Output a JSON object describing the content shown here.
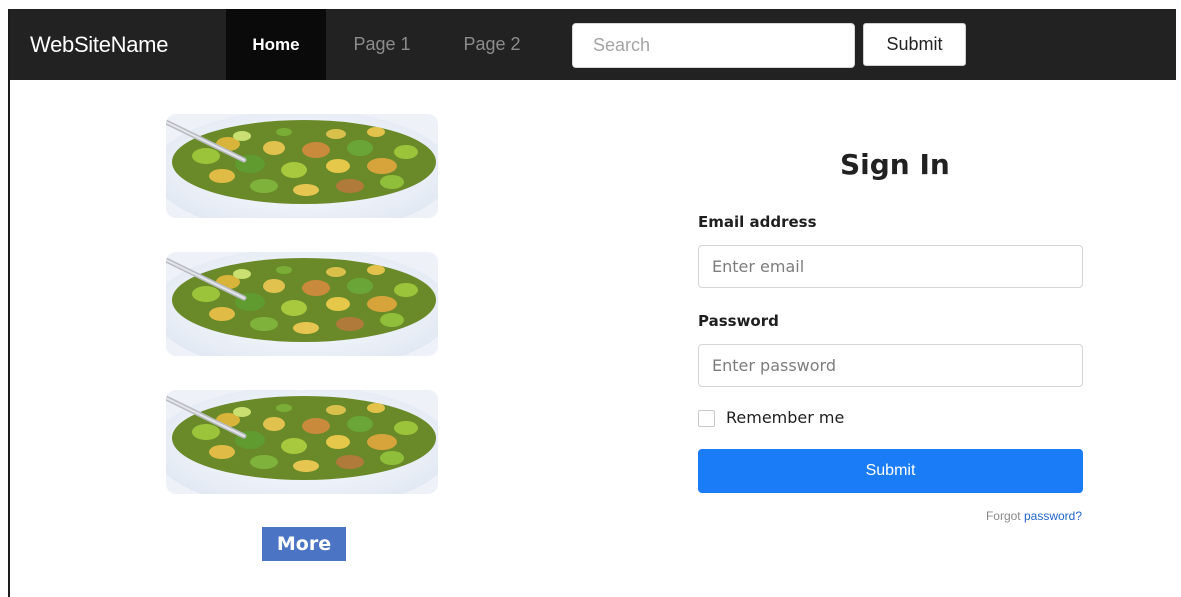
{
  "navbar": {
    "brand": "WebSiteName",
    "items": [
      {
        "label": "Home",
        "active": true
      },
      {
        "label": "Page 1",
        "active": false
      },
      {
        "label": "Page 2",
        "active": false
      }
    ],
    "search_placeholder": "Search",
    "submit_label": "Submit"
  },
  "gallery": {
    "images": [
      {
        "icon": "food-salad-image"
      },
      {
        "icon": "food-salad-image"
      },
      {
        "icon": "food-salad-image"
      }
    ],
    "more_label": "More"
  },
  "signin": {
    "title": "Sign In",
    "email_label": "Email address",
    "email_placeholder": "Enter email",
    "password_label": "Password",
    "password_placeholder": "Enter password",
    "remember_label": "Remember me",
    "remember_checked": false,
    "submit_label": "Submit",
    "forgot_prefix": "Forgot",
    "forgot_link": "password?"
  },
  "colors": {
    "navbar_bg": "#222222",
    "nav_active_bg": "#0a0a0a",
    "primary": "#1a7cf7",
    "more_button": "#4b75c4",
    "link": "#2266cc"
  }
}
